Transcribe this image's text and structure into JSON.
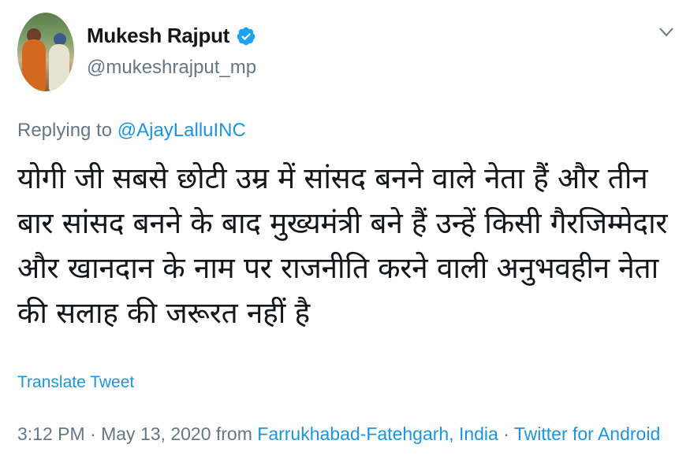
{
  "author": {
    "display_name": "Mukesh Rajput",
    "handle": "@mukeshrajput_mp",
    "verified": true
  },
  "reply": {
    "prefix": "Replying to ",
    "to_handle": "@AjayLalluINC"
  },
  "tweet": {
    "text": "योगी जी सबसे छोटी उम्र में सांसद बनने वाले नेता हैं और तीन बार सांसद बनने के बाद मुख्यमंत्री बने हैं उन्हें किसी गैरजिम्मेदार और खानदान के नाम पर राजनीति करने वाली अनुभवहीन नेता की सलाह की जरूरत नहीं है"
  },
  "actions": {
    "translate_label": "Translate Tweet"
  },
  "meta": {
    "time": "3:12 PM",
    "separator": " · ",
    "date": "May 13, 2020",
    "from_label": " from ",
    "location": "Farrukhabad-Fatehgarh, India",
    "source": "Twitter for Android"
  },
  "colors": {
    "link": "#1b95e0",
    "muted": "#657786",
    "text": "#14171a",
    "verified_badge": "#1da1f2"
  },
  "icons": {
    "verified": "verified-badge-icon",
    "menu": "chevron-down-icon"
  }
}
